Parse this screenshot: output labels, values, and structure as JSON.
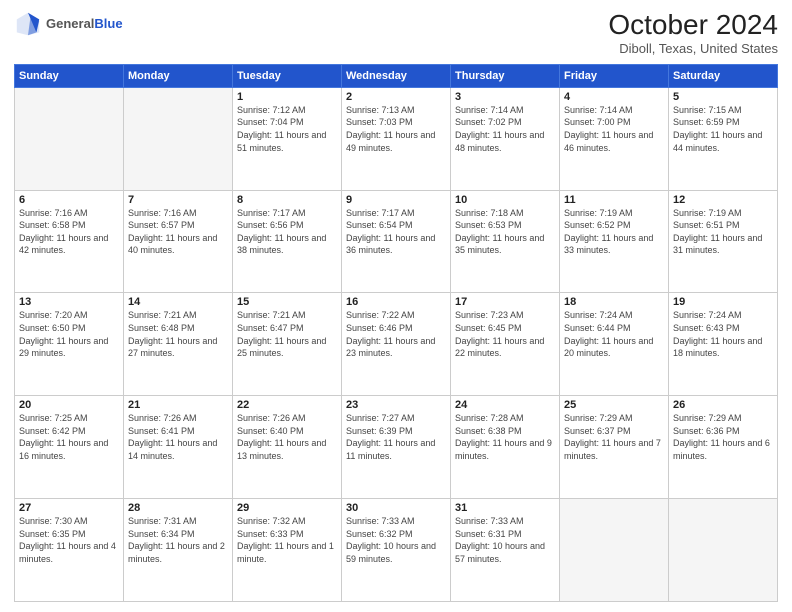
{
  "header": {
    "logo_line1": "General",
    "logo_line2": "Blue",
    "month": "October 2024",
    "location": "Diboll, Texas, United States"
  },
  "weekdays": [
    "Sunday",
    "Monday",
    "Tuesday",
    "Wednesday",
    "Thursday",
    "Friday",
    "Saturday"
  ],
  "weeks": [
    [
      {
        "day": "",
        "info": ""
      },
      {
        "day": "",
        "info": ""
      },
      {
        "day": "1",
        "info": "Sunrise: 7:12 AM\nSunset: 7:04 PM\nDaylight: 11 hours and 51 minutes."
      },
      {
        "day": "2",
        "info": "Sunrise: 7:13 AM\nSunset: 7:03 PM\nDaylight: 11 hours and 49 minutes."
      },
      {
        "day": "3",
        "info": "Sunrise: 7:14 AM\nSunset: 7:02 PM\nDaylight: 11 hours and 48 minutes."
      },
      {
        "day": "4",
        "info": "Sunrise: 7:14 AM\nSunset: 7:00 PM\nDaylight: 11 hours and 46 minutes."
      },
      {
        "day": "5",
        "info": "Sunrise: 7:15 AM\nSunset: 6:59 PM\nDaylight: 11 hours and 44 minutes."
      }
    ],
    [
      {
        "day": "6",
        "info": "Sunrise: 7:16 AM\nSunset: 6:58 PM\nDaylight: 11 hours and 42 minutes."
      },
      {
        "day": "7",
        "info": "Sunrise: 7:16 AM\nSunset: 6:57 PM\nDaylight: 11 hours and 40 minutes."
      },
      {
        "day": "8",
        "info": "Sunrise: 7:17 AM\nSunset: 6:56 PM\nDaylight: 11 hours and 38 minutes."
      },
      {
        "day": "9",
        "info": "Sunrise: 7:17 AM\nSunset: 6:54 PM\nDaylight: 11 hours and 36 minutes."
      },
      {
        "day": "10",
        "info": "Sunrise: 7:18 AM\nSunset: 6:53 PM\nDaylight: 11 hours and 35 minutes."
      },
      {
        "day": "11",
        "info": "Sunrise: 7:19 AM\nSunset: 6:52 PM\nDaylight: 11 hours and 33 minutes."
      },
      {
        "day": "12",
        "info": "Sunrise: 7:19 AM\nSunset: 6:51 PM\nDaylight: 11 hours and 31 minutes."
      }
    ],
    [
      {
        "day": "13",
        "info": "Sunrise: 7:20 AM\nSunset: 6:50 PM\nDaylight: 11 hours and 29 minutes."
      },
      {
        "day": "14",
        "info": "Sunrise: 7:21 AM\nSunset: 6:48 PM\nDaylight: 11 hours and 27 minutes."
      },
      {
        "day": "15",
        "info": "Sunrise: 7:21 AM\nSunset: 6:47 PM\nDaylight: 11 hours and 25 minutes."
      },
      {
        "day": "16",
        "info": "Sunrise: 7:22 AM\nSunset: 6:46 PM\nDaylight: 11 hours and 23 minutes."
      },
      {
        "day": "17",
        "info": "Sunrise: 7:23 AM\nSunset: 6:45 PM\nDaylight: 11 hours and 22 minutes."
      },
      {
        "day": "18",
        "info": "Sunrise: 7:24 AM\nSunset: 6:44 PM\nDaylight: 11 hours and 20 minutes."
      },
      {
        "day": "19",
        "info": "Sunrise: 7:24 AM\nSunset: 6:43 PM\nDaylight: 11 hours and 18 minutes."
      }
    ],
    [
      {
        "day": "20",
        "info": "Sunrise: 7:25 AM\nSunset: 6:42 PM\nDaylight: 11 hours and 16 minutes."
      },
      {
        "day": "21",
        "info": "Sunrise: 7:26 AM\nSunset: 6:41 PM\nDaylight: 11 hours and 14 minutes."
      },
      {
        "day": "22",
        "info": "Sunrise: 7:26 AM\nSunset: 6:40 PM\nDaylight: 11 hours and 13 minutes."
      },
      {
        "day": "23",
        "info": "Sunrise: 7:27 AM\nSunset: 6:39 PM\nDaylight: 11 hours and 11 minutes."
      },
      {
        "day": "24",
        "info": "Sunrise: 7:28 AM\nSunset: 6:38 PM\nDaylight: 11 hours and 9 minutes."
      },
      {
        "day": "25",
        "info": "Sunrise: 7:29 AM\nSunset: 6:37 PM\nDaylight: 11 hours and 7 minutes."
      },
      {
        "day": "26",
        "info": "Sunrise: 7:29 AM\nSunset: 6:36 PM\nDaylight: 11 hours and 6 minutes."
      }
    ],
    [
      {
        "day": "27",
        "info": "Sunrise: 7:30 AM\nSunset: 6:35 PM\nDaylight: 11 hours and 4 minutes."
      },
      {
        "day": "28",
        "info": "Sunrise: 7:31 AM\nSunset: 6:34 PM\nDaylight: 11 hours and 2 minutes."
      },
      {
        "day": "29",
        "info": "Sunrise: 7:32 AM\nSunset: 6:33 PM\nDaylight: 11 hours and 1 minute."
      },
      {
        "day": "30",
        "info": "Sunrise: 7:33 AM\nSunset: 6:32 PM\nDaylight: 10 hours and 59 minutes."
      },
      {
        "day": "31",
        "info": "Sunrise: 7:33 AM\nSunset: 6:31 PM\nDaylight: 10 hours and 57 minutes."
      },
      {
        "day": "",
        "info": ""
      },
      {
        "day": "",
        "info": ""
      }
    ]
  ]
}
